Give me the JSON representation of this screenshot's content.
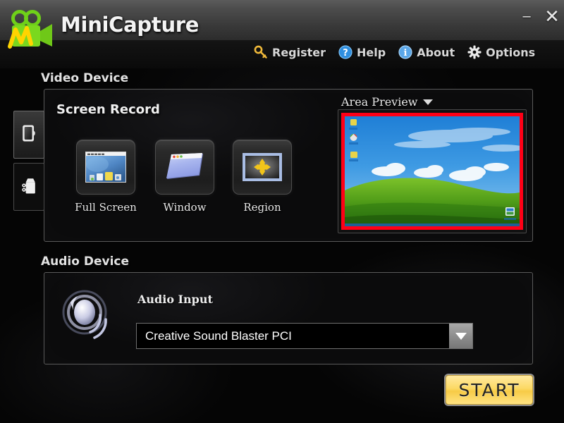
{
  "window": {
    "title": "MiniCapture",
    "logo_icon": "video-camera-m-logo-icon",
    "minimize_label": "–",
    "close_label": "✕"
  },
  "menu": [
    {
      "label": "Register",
      "icon": "key-icon"
    },
    {
      "label": "Help",
      "icon": "question-circle-icon"
    },
    {
      "label": "About",
      "icon": "info-circle-icon"
    },
    {
      "label": "Options",
      "icon": "gear-icon"
    }
  ],
  "sections": {
    "video_caption": "Video Device",
    "audio_caption": "Audio Device"
  },
  "sidebar": {
    "items": [
      {
        "name": "screen-capture-tab",
        "icon": "monitor-icon",
        "selected": true
      },
      {
        "name": "video-camera-tab",
        "icon": "camcorder-icon",
        "selected": false
      }
    ]
  },
  "video_panel": {
    "title": "Screen Record",
    "modes": [
      {
        "label": "Full Screen",
        "icon": "desktop-thumbnail-icon"
      },
      {
        "label": "Window",
        "icon": "window-thumbnail-icon"
      },
      {
        "label": "Region",
        "icon": "move-arrows-icon"
      }
    ],
    "preview": {
      "label": "Area Preview",
      "caret_icon": "chevron-down-icon",
      "border_color": "#ff0016",
      "content": "windows-xp-bliss-wallpaper"
    }
  },
  "audio_panel": {
    "icon": "speaker-waves-icon",
    "input_label": "Audio Input",
    "selected_device": "Creative Sound Blaster PCI",
    "dropdown_icon": "chevron-down-icon"
  },
  "actions": {
    "start_label": "START",
    "start_color": "#fcd964"
  }
}
